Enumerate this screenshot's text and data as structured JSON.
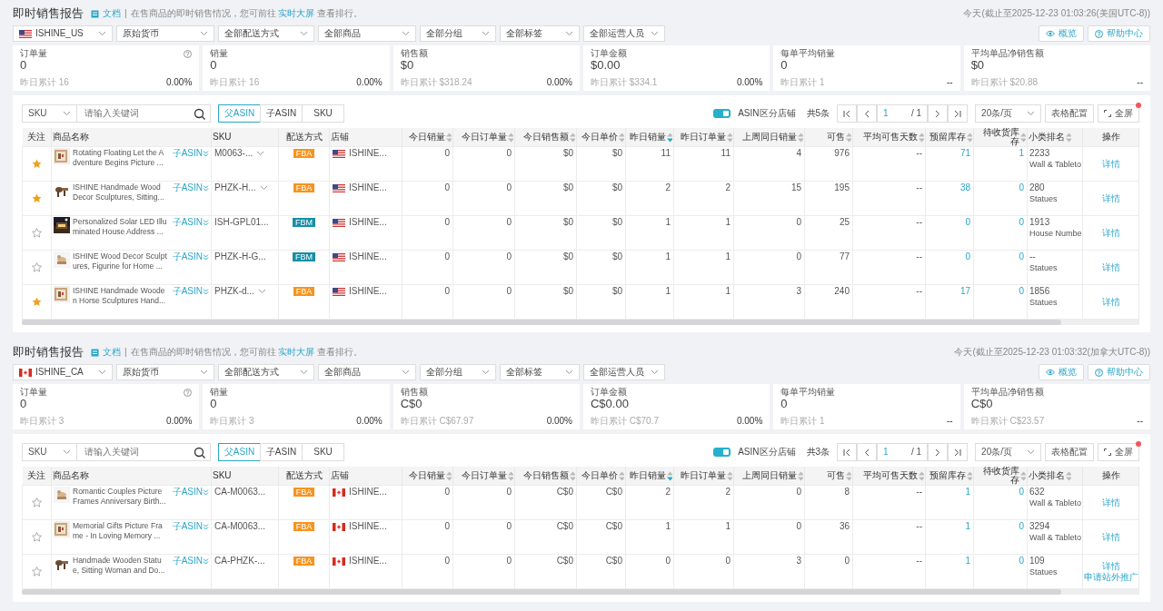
{
  "reports": [
    {
      "title": "即时销售报告",
      "doc_link": "文档",
      "description": {
        "before": "在售商品的即时销售情况，您可前往",
        "link": "实时大屏",
        "after": "查看排行。"
      },
      "separator": "|",
      "timestamp": "今天(截止至2025-12-23 01:03:26(美国UTC-8))",
      "kind": "us",
      "filters": [
        {
          "label": "ISHINE_US",
          "flag": true
        },
        {
          "label": "原始货币",
          "flag": false
        },
        {
          "label": "全部配送方式",
          "flag": false
        },
        {
          "label": "全部商品",
          "flag": false
        },
        {
          "label": "全部分组",
          "flag": false
        },
        {
          "label": "全部标签",
          "flag": false
        },
        {
          "label": "全部运营人员",
          "flag": false
        }
      ],
      "buttons": [
        {
          "label": "概览",
          "kind": "overview"
        },
        {
          "label": "帮助中心",
          "kind": "help"
        }
      ],
      "stats": [
        {
          "label": "订单量",
          "help": true,
          "value": "0",
          "yesterday": "昨日累计 16",
          "change": "0.00%"
        },
        {
          "label": "销量",
          "help": false,
          "value": "0",
          "yesterday": "昨日累计 16",
          "change": "0.00%"
        },
        {
          "label": "销售额",
          "help": false,
          "value": "$0",
          "yesterday": "昨日累计 $318.24",
          "change": "0.00%"
        },
        {
          "label": "订单金额",
          "help": false,
          "value": "$0.00",
          "yesterday": "昨日累计 $334.1",
          "change": "0.00%"
        },
        {
          "label": "每单平均销量",
          "help": false,
          "value": "0",
          "yesterday": "昨日累计 1",
          "change": "--"
        },
        {
          "label": "平均单品净销售额",
          "help": false,
          "value": "$0",
          "yesterday": "昨日累计 $20.88",
          "change": "--"
        }
      ],
      "toolbar": {
        "search_type": "SKU",
        "placeholder": "请输入关键词",
        "tabs": [
          {
            "label": "父ASIN",
            "selected": true
          },
          {
            "label": "子ASIN",
            "selected": false
          },
          {
            "label": "SKU",
            "selected": false
          }
        ],
        "toggle": {
          "label": "ASIN区分店铺",
          "on": true
        },
        "total": "共5条",
        "page": "1",
        "pages": "/ 1",
        "page_size": "20条/页",
        "config_button": "表格配置",
        "fullscreen_button": "全屏",
        "notice": true
      },
      "columns": [
        {
          "label": "关注",
          "kind": "star",
          "sortable": false
        },
        {
          "label": "商品名称",
          "kind": "name",
          "sortable": false
        },
        {
          "label": "SKU",
          "kind": "sku",
          "sortable": false
        },
        {
          "label": "配送方式",
          "kind": "ship",
          "sortable": false
        },
        {
          "label": "店铺",
          "kind": "store",
          "sortable": false
        },
        {
          "label": "今日销量",
          "kind": "num",
          "sortable": true,
          "sorted": false
        },
        {
          "label": "今日订单量",
          "kind": "num",
          "sortable": true,
          "sorted": false
        },
        {
          "label": "今日销售额",
          "kind": "num",
          "sortable": true,
          "sorted": false
        },
        {
          "label": "今日单价",
          "kind": "num",
          "sortable": true,
          "sorted": false
        },
        {
          "label": "昨日销量",
          "kind": "num",
          "sortable": true,
          "sorted": true
        },
        {
          "label": "昨日订单量",
          "kind": "num",
          "sortable": true,
          "sorted": false
        },
        {
          "label": "上周同日销量",
          "kind": "num",
          "sortable": true,
          "sorted": false
        },
        {
          "label": "可售",
          "kind": "num",
          "sortable": true,
          "sorted": false
        },
        {
          "label": "平均可售天数",
          "kind": "num",
          "sortable": true,
          "sorted": false
        },
        {
          "label": "预留库存",
          "kind": "link",
          "sortable": true,
          "sorted": false
        },
        {
          "label": "待收货库存",
          "kind": "link",
          "sortable": true,
          "sorted": false
        },
        {
          "label": "小类排名",
          "kind": "rank",
          "sortable": true,
          "sorted": false
        },
        {
          "label": "操作",
          "kind": "action",
          "sortable": false
        }
      ],
      "rows": [
        {
          "starred": true,
          "name": "Rotating Floating Let the Adventure Begins Picture ...",
          "asin_link": "子ASIN",
          "sku": "M0063-...",
          "sku_dropdown": true,
          "ship": {
            "label": "FBA",
            "kind": "fba"
          },
          "store": "ISHINE...",
          "metrics": [
            "0",
            "0",
            "$0",
            "$0",
            "11",
            "11",
            "4",
            "976",
            "--",
            "71",
            "1"
          ],
          "rank": "2233",
          "category": "Wall & Tableto",
          "actions": [
            "详情"
          ]
        },
        {
          "starred": true,
          "name": "ISHINE Handmade Wood Decor Sculptures, Sitting...",
          "asin_link": "子ASIN",
          "sku": "PHZK-H...",
          "sku_dropdown": true,
          "ship": {
            "label": "FBA",
            "kind": "fba"
          },
          "store": "ISHINE...",
          "metrics": [
            "0",
            "0",
            "$0",
            "$0",
            "2",
            "2",
            "15",
            "195",
            "--",
            "38",
            "0"
          ],
          "rank": "280",
          "category": "Statues",
          "actions": [
            "详情"
          ]
        },
        {
          "starred": false,
          "name": "Personalized Solar LED Illuminated House Address ...",
          "asin_link": "子ASIN",
          "sku": "ISH-GPL01...",
          "sku_dropdown": false,
          "ship": {
            "label": "FBM",
            "kind": "fbm"
          },
          "store": "ISHINE...",
          "metrics": [
            "0",
            "0",
            "$0",
            "$0",
            "1",
            "1",
            "0",
            "25",
            "--",
            "0",
            "0"
          ],
          "rank": "1913",
          "category": "House Numbe",
          "actions": [
            "详情"
          ]
        },
        {
          "starred": false,
          "name": "ISHINE Wood Decor Sculptures, Figurine for Home ...",
          "asin_link": "子ASIN",
          "sku": "PHZK-H-G...",
          "sku_dropdown": false,
          "ship": {
            "label": "FBM",
            "kind": "fbm"
          },
          "store": "ISHINE...",
          "metrics": [
            "0",
            "0",
            "$0",
            "$0",
            "1",
            "1",
            "0",
            "77",
            "--",
            "0",
            "0"
          ],
          "rank": "--",
          "category": "Statues",
          "actions": [
            "详情"
          ]
        },
        {
          "starred": true,
          "name": "ISHINE Handmade Wooden Horse Sculptures Hand...",
          "asin_link": "子ASIN",
          "sku": "PHZK-d...",
          "sku_dropdown": true,
          "ship": {
            "label": "FBA",
            "kind": "fba"
          },
          "store": "ISHINE...",
          "metrics": [
            "0",
            "0",
            "$0",
            "$0",
            "1",
            "1",
            "3",
            "240",
            "--",
            "17",
            "0"
          ],
          "rank": "1856",
          "category": "Statues",
          "actions": [
            "详情"
          ]
        }
      ]
    },
    {
      "title": "即时销售报告",
      "doc_link": "文档",
      "description": {
        "before": "在售商品的即时销售情况，您可前往",
        "link": "实时大屏",
        "after": "查看排行。"
      },
      "separator": "|",
      "timestamp": "今天(截止至2025-12-23 01:03:32(加拿大UTC-8))",
      "kind": "ca",
      "filters": [
        {
          "label": "ISHINE_CA",
          "flag": true
        },
        {
          "label": "原始货币",
          "flag": false
        },
        {
          "label": "全部配送方式",
          "flag": false
        },
        {
          "label": "全部商品",
          "flag": false
        },
        {
          "label": "全部分组",
          "flag": false
        },
        {
          "label": "全部标签",
          "flag": false
        },
        {
          "label": "全部运营人员",
          "flag": false
        }
      ],
      "buttons": [
        {
          "label": "概览",
          "kind": "overview"
        },
        {
          "label": "帮助中心",
          "kind": "help"
        }
      ],
      "stats": [
        {
          "label": "订单量",
          "help": true,
          "value": "0",
          "yesterday": "昨日累计 3",
          "change": "0.00%"
        },
        {
          "label": "销量",
          "help": false,
          "value": "0",
          "yesterday": "昨日累计 3",
          "change": "0.00%"
        },
        {
          "label": "销售额",
          "help": false,
          "value": "C$0",
          "yesterday": "昨日累计 C$67.97",
          "change": "0.00%"
        },
        {
          "label": "订单金额",
          "help": false,
          "value": "C$0.00",
          "yesterday": "昨日累计 C$70.7",
          "change": "0.00%"
        },
        {
          "label": "每单平均销量",
          "help": false,
          "value": "0",
          "yesterday": "昨日累计 1",
          "change": "--"
        },
        {
          "label": "平均单品净销售额",
          "help": false,
          "value": "C$0",
          "yesterday": "昨日累计 C$23.57",
          "change": "--"
        }
      ],
      "toolbar": {
        "search_type": "SKU",
        "placeholder": "请输入关键词",
        "tabs": [
          {
            "label": "父ASIN",
            "selected": true
          },
          {
            "label": "子ASIN",
            "selected": false
          },
          {
            "label": "SKU",
            "selected": false
          }
        ],
        "toggle": {
          "label": "ASIN区分店铺",
          "on": true
        },
        "total": "共3条",
        "page": "1",
        "pages": "/ 1",
        "page_size": "20条/页",
        "config_button": "表格配置",
        "fullscreen_button": "全屏",
        "notice": true
      },
      "columns": [
        {
          "label": "关注",
          "kind": "star",
          "sortable": false
        },
        {
          "label": "商品名称",
          "kind": "name",
          "sortable": false
        },
        {
          "label": "SKU",
          "kind": "sku",
          "sortable": false
        },
        {
          "label": "配送方式",
          "kind": "ship",
          "sortable": false
        },
        {
          "label": "店铺",
          "kind": "store",
          "sortable": false
        },
        {
          "label": "今日销量",
          "kind": "num",
          "sortable": true,
          "sorted": false
        },
        {
          "label": "今日订单量",
          "kind": "num",
          "sortable": true,
          "sorted": false
        },
        {
          "label": "今日销售额",
          "kind": "num",
          "sortable": true,
          "sorted": false
        },
        {
          "label": "今日单价",
          "kind": "num",
          "sortable": true,
          "sorted": false
        },
        {
          "label": "昨日销量",
          "kind": "num",
          "sortable": true,
          "sorted": true
        },
        {
          "label": "昨日订单量",
          "kind": "num",
          "sortable": true,
          "sorted": false
        },
        {
          "label": "上周同日销量",
          "kind": "num",
          "sortable": true,
          "sorted": false
        },
        {
          "label": "可售",
          "kind": "num",
          "sortable": true,
          "sorted": false
        },
        {
          "label": "平均可售天数",
          "kind": "num",
          "sortable": true,
          "sorted": false
        },
        {
          "label": "预留库存",
          "kind": "link",
          "sortable": true,
          "sorted": false
        },
        {
          "label": "待收货库存",
          "kind": "link",
          "sortable": true,
          "sorted": false
        },
        {
          "label": "小类排名",
          "kind": "rank",
          "sortable": true,
          "sorted": false
        },
        {
          "label": "操作",
          "kind": "action",
          "sortable": false
        }
      ],
      "rows": [
        {
          "starred": false,
          "name": "Romantic Couples Picture Frames Anniversary Birth...",
          "asin_link": "子ASIN",
          "sku": "CA-M0063...",
          "sku_dropdown": false,
          "ship": {
            "label": "FBA",
            "kind": "fba"
          },
          "store": "ISHINE...",
          "metrics": [
            "0",
            "0",
            "C$0",
            "C$0",
            "2",
            "2",
            "0",
            "8",
            "--",
            "1",
            "0"
          ],
          "rank": "632",
          "category": "Wall & Tableto",
          "actions": [
            "详情"
          ]
        },
        {
          "starred": false,
          "name": "Memorial Gifts Picture Frame - In Loving Memory ...",
          "asin_link": "子ASIN",
          "sku": "CA-M0063...",
          "sku_dropdown": false,
          "ship": {
            "label": "FBA",
            "kind": "fba"
          },
          "store": "ISHINE...",
          "metrics": [
            "0",
            "0",
            "C$0",
            "C$0",
            "1",
            "1",
            "0",
            "36",
            "--",
            "1",
            "0"
          ],
          "rank": "3294",
          "category": "Wall & Tableto",
          "actions": [
            "详情"
          ]
        },
        {
          "starred": false,
          "name": "Handmade Wooden Statue, Sitting Woman and Do...",
          "asin_link": "子ASIN",
          "sku": "CA-PHZK-...",
          "sku_dropdown": false,
          "ship": {
            "label": "FBA",
            "kind": "fba"
          },
          "store": "ISHINE...",
          "metrics": [
            "0",
            "0",
            "C$0",
            "C$0",
            "0",
            "0",
            "3",
            "0",
            "--",
            "1",
            "0"
          ],
          "rank": "109",
          "category": "Statues",
          "actions": [
            "详情",
            "申请站外推广"
          ]
        }
      ]
    }
  ]
}
